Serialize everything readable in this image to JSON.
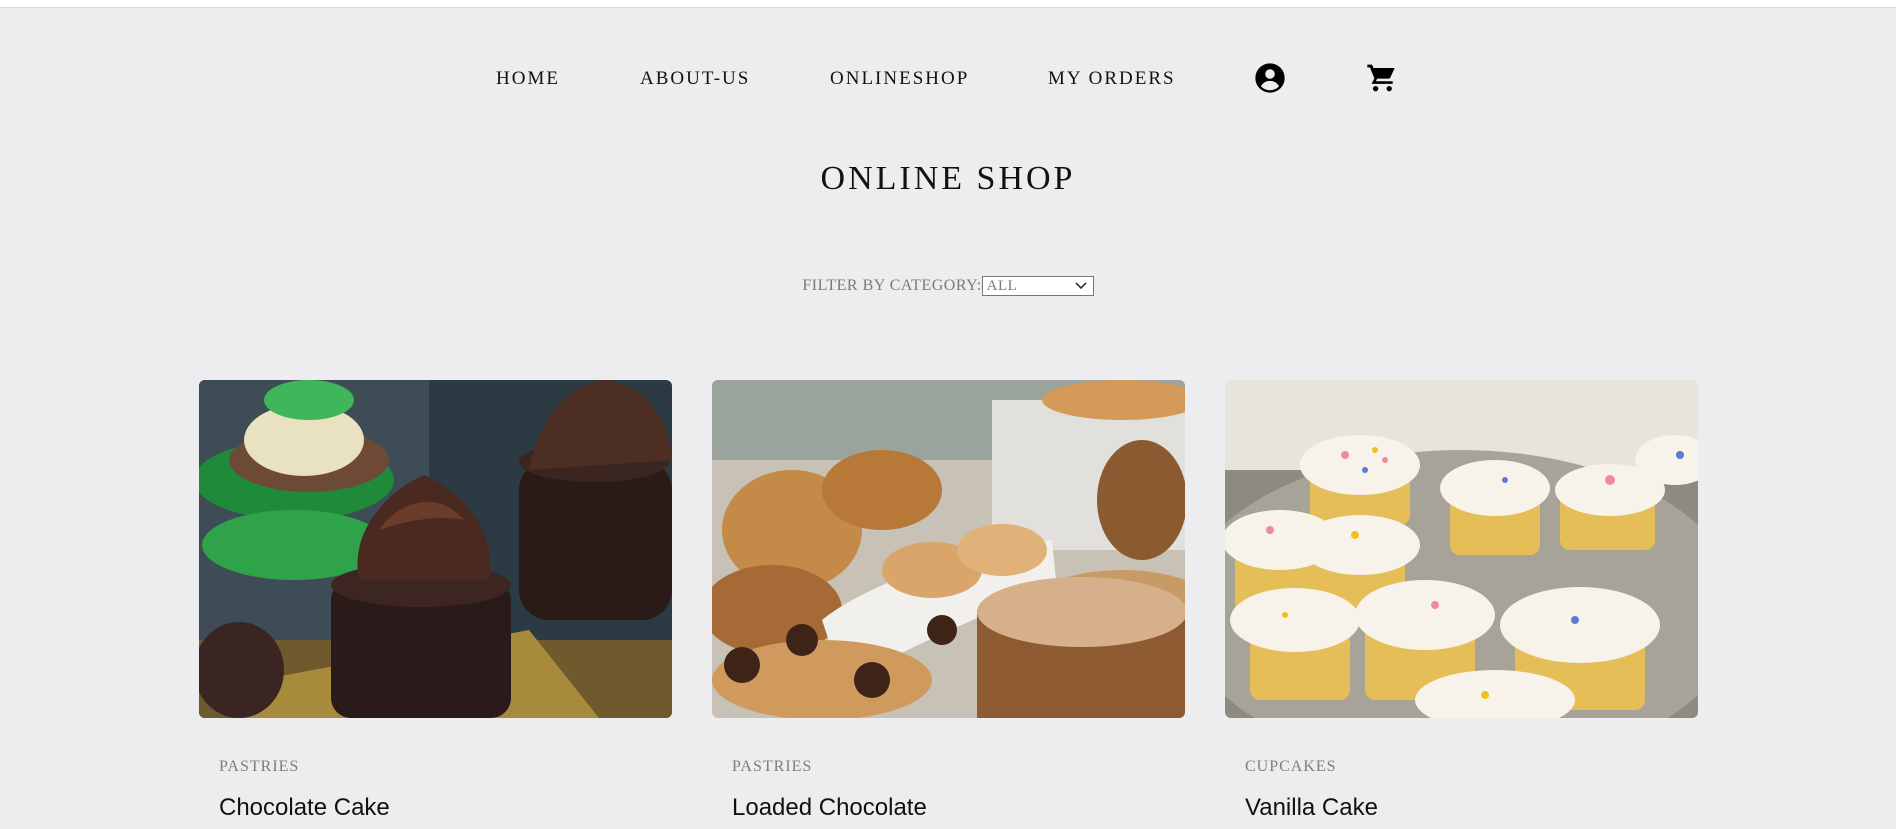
{
  "nav": {
    "home": "HOME",
    "about": "ABOUT-US",
    "shop": "ONLINESHOP",
    "orders": "MY ORDERS",
    "account_icon": "account-circle-icon",
    "cart_icon": "shopping-cart-icon"
  },
  "page": {
    "title": "ONLINE SHOP"
  },
  "filter": {
    "label": "FILTER BY CATEGORY:",
    "selected": "ALL"
  },
  "products": [
    {
      "category": "PASTRIES",
      "name": "Chocolate Cake"
    },
    {
      "category": "PASTRIES",
      "name": "Loaded Chocolate"
    },
    {
      "category": "CUPCAKES",
      "name": "Vanilla Cake"
    }
  ],
  "colors": {
    "background": "#ededef",
    "text": "#111111",
    "muted": "#7a7a7a"
  }
}
